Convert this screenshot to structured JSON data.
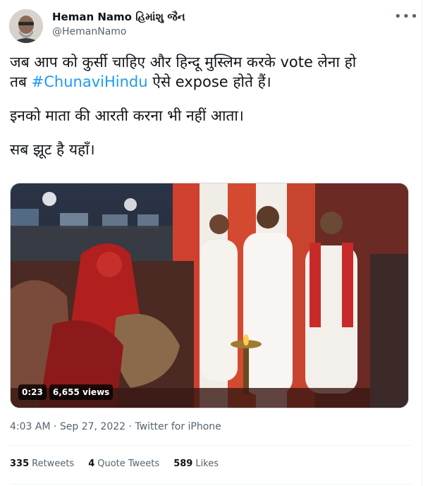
{
  "author": {
    "name": "Heman Namo હિમાંશુ જૈન",
    "handle": "@HemanNamo"
  },
  "tweet": {
    "line1": "जब आप को कुर्सी चाहिए और हिन्दू मुस्लिम करके vote लेना हो",
    "line2_prefix": "तब ",
    "hashtag": "#ChunaviHindu",
    "line2_suffix": " ऐसे expose होते हैं।",
    "line3": "इनको माता की आरती करना भी नहीं आता।",
    "line4": "सब झूट है यहाँ।"
  },
  "video": {
    "duration": "0:23",
    "views": "6,655 views"
  },
  "meta": {
    "time": "4:03 AM",
    "separator": "·",
    "date": "Sep 27, 2022",
    "source": "Twitter for iPhone"
  },
  "stats": {
    "retweets_count": "335",
    "retweets_label": "Retweets",
    "quotes_count": "4",
    "quotes_label": "Quote Tweets",
    "likes_count": "589",
    "likes_label": "Likes"
  },
  "icons": {
    "more": "more-options-icon"
  }
}
